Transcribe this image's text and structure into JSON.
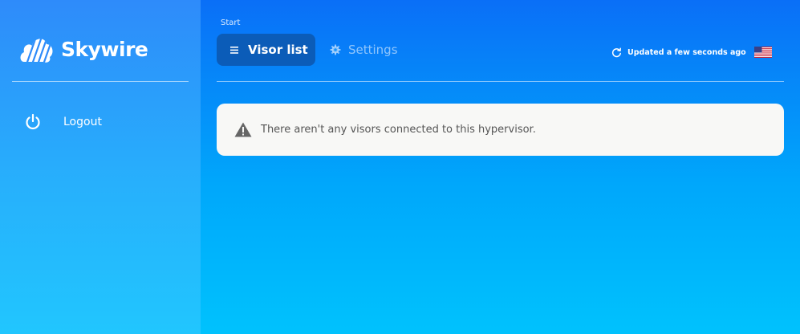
{
  "app": {
    "name": "Skywire"
  },
  "sidebar": {
    "items": [
      {
        "label": "Logout",
        "icon": "power-icon"
      }
    ]
  },
  "header": {
    "breadcrumb": "Start",
    "tabs": [
      {
        "label": "Visor list",
        "icon": "list-icon",
        "active": true
      },
      {
        "label": "Settings",
        "icon": "gear-icon",
        "active": false
      }
    ],
    "updated_text": "Updated a few seconds ago",
    "language_icon": "us-flag-icon"
  },
  "alert": {
    "icon": "warning-icon",
    "message": "There aren't any visors connected to this hypervisor."
  },
  "colors": {
    "active_tab": "#0b5cb8",
    "alert_bg": "#f8f8f6",
    "alert_text": "#555555"
  }
}
